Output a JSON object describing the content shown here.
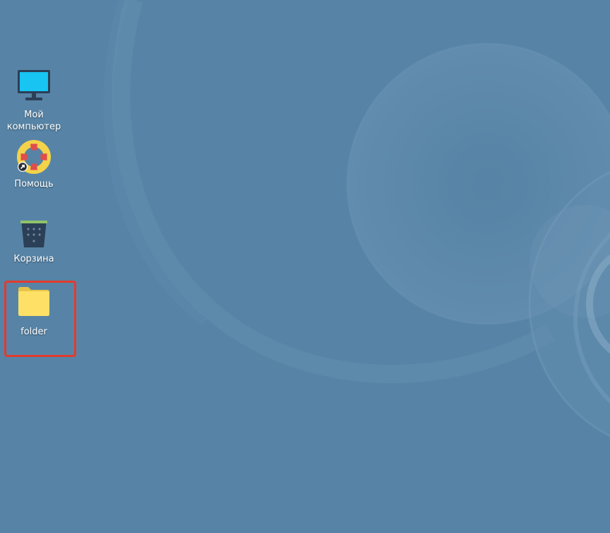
{
  "desktop": {
    "background_color": "#5784a6",
    "icons": [
      {
        "name": "computer-icon",
        "label": "Мой\nкомпьютер"
      },
      {
        "name": "help-icon",
        "label": "Помощь"
      },
      {
        "name": "trash-icon",
        "label": "Корзина"
      },
      {
        "name": "folder-icon",
        "label": "folder"
      }
    ],
    "highlight_color": "#e23b2e"
  }
}
